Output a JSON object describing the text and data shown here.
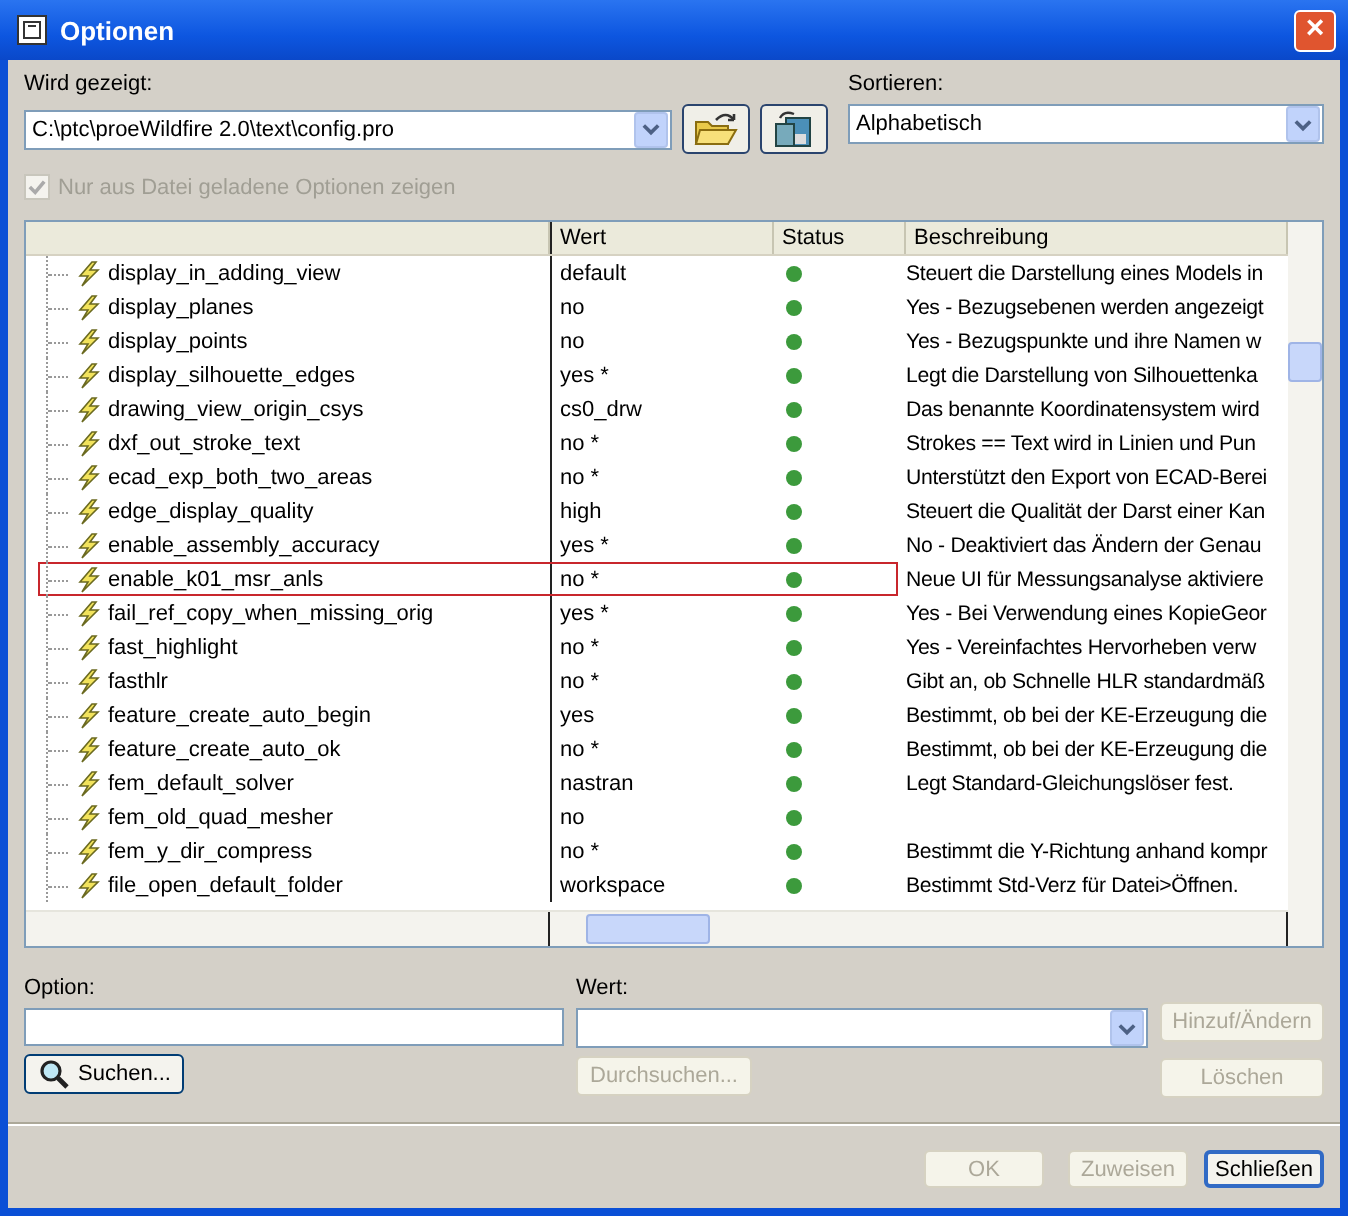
{
  "window": {
    "title": "Optionen",
    "close": "×"
  },
  "shown": {
    "label": "Wird gezeigt:",
    "value": "C:\\ptc\\proeWildfire 2.0\\text\\config.pro"
  },
  "sort": {
    "label": "Sortieren:",
    "value": "Alphabetisch"
  },
  "only_loaded": {
    "label": "Nur aus Datei geladene Optionen zeigen",
    "checked": true,
    "disabled": true
  },
  "table": {
    "columns": [
      "Wert",
      "Status",
      "Beschreibung"
    ],
    "rows": [
      {
        "name": "display_in_adding_view",
        "value": "default",
        "description": "Steuert die Darstellung eines Models in",
        "selected": false
      },
      {
        "name": "display_planes",
        "value": "no",
        "description": "Yes - Bezugsebenen werden angezeigt",
        "selected": false
      },
      {
        "name": "display_points",
        "value": "no",
        "description": "Yes - Bezugspunkte und ihre Namen w",
        "selected": false
      },
      {
        "name": "display_silhouette_edges",
        "value": "yes *",
        "description": "Legt die Darstellung von Silhouettenka",
        "selected": false
      },
      {
        "name": "drawing_view_origin_csys",
        "value": "cs0_drw",
        "description": "Das benannte Koordinatensystem wird",
        "selected": false
      },
      {
        "name": "dxf_out_stroke_text",
        "value": "no *",
        "description": "Strokes == Text wird in Linien und Pun",
        "selected": false
      },
      {
        "name": "ecad_exp_both_two_areas",
        "value": "no *",
        "description": "Unterstützt den Export von ECAD-Berei",
        "selected": false
      },
      {
        "name": "edge_display_quality",
        "value": "high",
        "description": "Steuert die Qualität der Darst einer Kan",
        "selected": false
      },
      {
        "name": "enable_assembly_accuracy",
        "value": "yes *",
        "description": "No - Deaktiviert das Ändern der Genau",
        "selected": false
      },
      {
        "name": "enable_k01_msr_anls",
        "value": "no *",
        "description": "Neue UI für Messungsanalyse aktiviere",
        "selected": true
      },
      {
        "name": "fail_ref_copy_when_missing_orig",
        "value": "yes *",
        "description": "Yes - Bei Verwendung eines KopieGeor",
        "selected": false
      },
      {
        "name": "fast_highlight",
        "value": "no *",
        "description": "Yes - Vereinfachtes Hervorheben verw",
        "selected": false
      },
      {
        "name": "fasthlr",
        "value": "no *",
        "description": "Gibt an, ob Schnelle HLR standardmäß",
        "selected": false
      },
      {
        "name": "feature_create_auto_begin",
        "value": "yes",
        "description": "Bestimmt, ob bei der KE-Erzeugung die",
        "selected": false
      },
      {
        "name": "feature_create_auto_ok",
        "value": "no *",
        "description": "Bestimmt, ob bei der KE-Erzeugung die",
        "selected": false
      },
      {
        "name": "fem_default_solver",
        "value": "nastran",
        "description": "Legt Standard-Gleichungslöser fest.",
        "selected": false
      },
      {
        "name": "fem_old_quad_mesher",
        "value": "no",
        "selected": false
      },
      {
        "name": "fem_y_dir_compress",
        "value": "no *",
        "description": "Bestimmt die Y-Richtung anhand kompr",
        "selected": false
      },
      {
        "name": "file_open_default_folder",
        "value": "workspace",
        "description": "Bestimmt Std-Verz für Datei>Öffnen.",
        "selected": false
      }
    ]
  },
  "option": {
    "label": "Option:"
  },
  "wert": {
    "label": "Wert:"
  },
  "buttons": [
    {
      "kind": "search",
      "label": "Suchen...",
      "disabled": false
    },
    {
      "kind": "browse",
      "label": "Durchsuchen...",
      "disabled": true
    },
    {
      "kind": "add",
      "label": "Hinzuf/Ändern",
      "disabled": true
    },
    {
      "kind": "delete",
      "label": "Löschen",
      "disabled": true
    },
    {
      "kind": "ok",
      "label": "OK",
      "disabled": true
    },
    {
      "kind": "apply",
      "label": "Zuweisen",
      "disabled": true
    },
    {
      "kind": "close",
      "label": "Schließen",
      "disabled": false
    }
  ]
}
